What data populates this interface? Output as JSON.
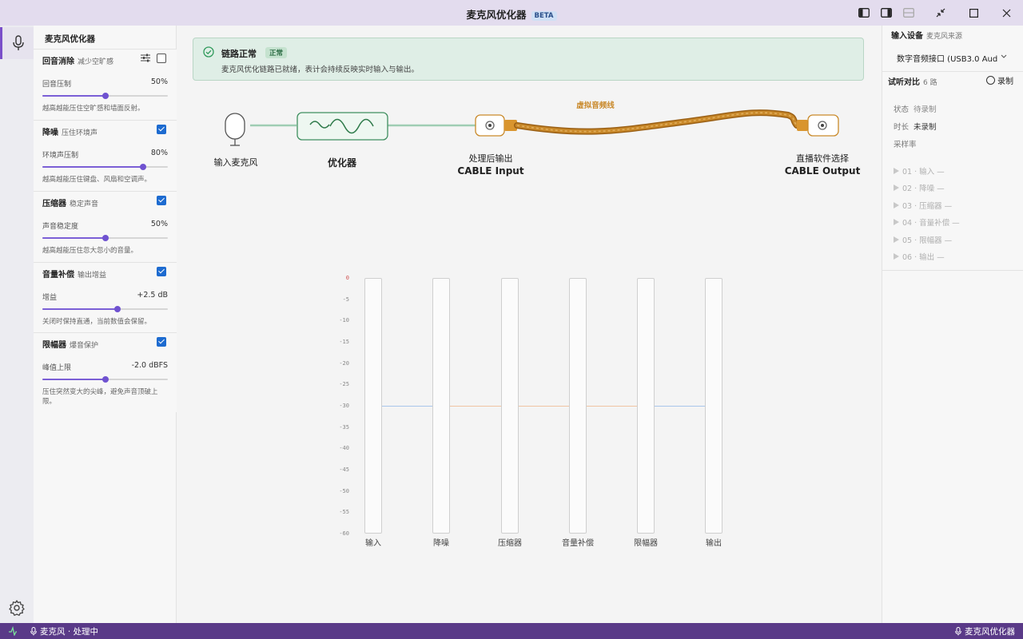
{
  "window": {
    "title": "麦克风优化器",
    "badge": "BETA"
  },
  "left_panel": {
    "title": "麦克风优化器",
    "modules": [
      {
        "name": "回音消除",
        "sub": "减少空旷感",
        "enabled": false,
        "param_label": "回音压制",
        "value": "50%",
        "level": 0.5,
        "description": "越高越能压住空旷感和墙面反射。"
      },
      {
        "name": "降噪",
        "sub": "压住环境声",
        "enabled": true,
        "param_label": "环境声压制",
        "value": "80%",
        "level": 0.8,
        "description": "越高越能压住键盘、风扇和空调声。"
      },
      {
        "name": "压缩器",
        "sub": "稳定声音",
        "enabled": true,
        "param_label": "声音稳定度",
        "value": "50%",
        "level": 0.5,
        "description": "越高越能压住忽大忽小的音量。"
      },
      {
        "name": "音量补偿",
        "sub": "输出增益",
        "enabled": true,
        "param_label": "增益",
        "value": "+2.5 dB",
        "level": 0.6,
        "description": "关闭时保持直通，当前数值会保留。"
      },
      {
        "name": "限幅器",
        "sub": "爆音保护",
        "enabled": true,
        "param_label": "峰值上限",
        "value": "-2.0 dBFS",
        "level": 0.5,
        "description": "压住突然变大的尖峰，避免声音顶破上限。"
      }
    ]
  },
  "banner": {
    "title": "链路正常",
    "badge": "正常",
    "text": "麦克风优化链路已就绪，表计会持续反映实时输入与输出。"
  },
  "flow": {
    "mic_label": "输入麦克风",
    "optimizer_label": "优化器",
    "processed_label_1": "处理后输出",
    "processed_label_2": "CABLE Input",
    "cable_label": "虚拟音频线",
    "target_label_1": "直播软件选择",
    "target_label_2": "CABLE Output"
  },
  "meters": {
    "scale": [
      "0",
      "-5",
      "-10",
      "-15",
      "-20",
      "-25",
      "-30",
      "-35",
      "-40",
      "-45",
      "-50",
      "-55",
      "-60"
    ],
    "level_db": -30,
    "channels": [
      "输入",
      "降噪",
      "压缩器",
      "音量补偿",
      "限幅器",
      "输出"
    ],
    "colors": {
      "input": "#a8c6ea",
      "process": "#f0c4a2"
    }
  },
  "right_panel": {
    "device_header": "输入设备",
    "device_sub": "麦克风来源",
    "device_value": "数字音频接口 (USB3.0 Aud",
    "compare_header": "试听对比",
    "compare_sub": "6 路",
    "record_label": "录制",
    "status_key": "状态",
    "status_value": "待录制",
    "duration_key": "时长",
    "duration_value": "未录制",
    "samplerate_key": "采样率",
    "steps": [
      "01 · 输入  —",
      "02 · 降噪  —",
      "03 · 压缩器  —",
      "04 · 音量补偿  —",
      "05 · 限幅器  —",
      "06 · 输出  —"
    ]
  },
  "statusbar": {
    "left": "麦克风 · 处理中",
    "right": "麦克风优化器"
  },
  "colors": {
    "accent": "#6f52d0",
    "statusbar": "#5a3a88",
    "cable": "#c98a2a",
    "ok": "#2f9a5b"
  }
}
